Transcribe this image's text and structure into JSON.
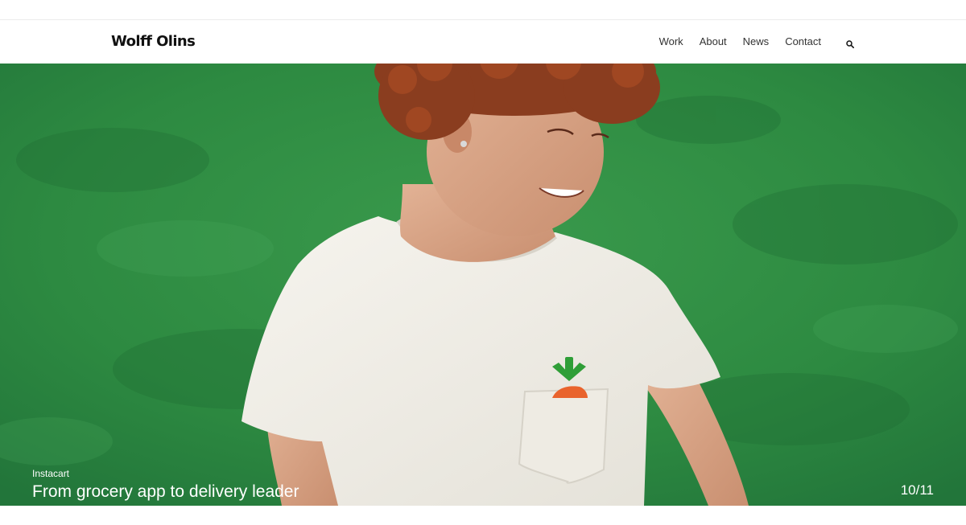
{
  "header": {
    "logo_text": "Wolff Olins",
    "nav": [
      {
        "label": "Work"
      },
      {
        "label": "About"
      },
      {
        "label": "News"
      },
      {
        "label": "Contact"
      }
    ],
    "search_icon": "search-icon"
  },
  "hero": {
    "client": "Instacart",
    "title": "From grocery app to delivery leader",
    "counter": "10/11",
    "background_color": "#2e8a42"
  }
}
